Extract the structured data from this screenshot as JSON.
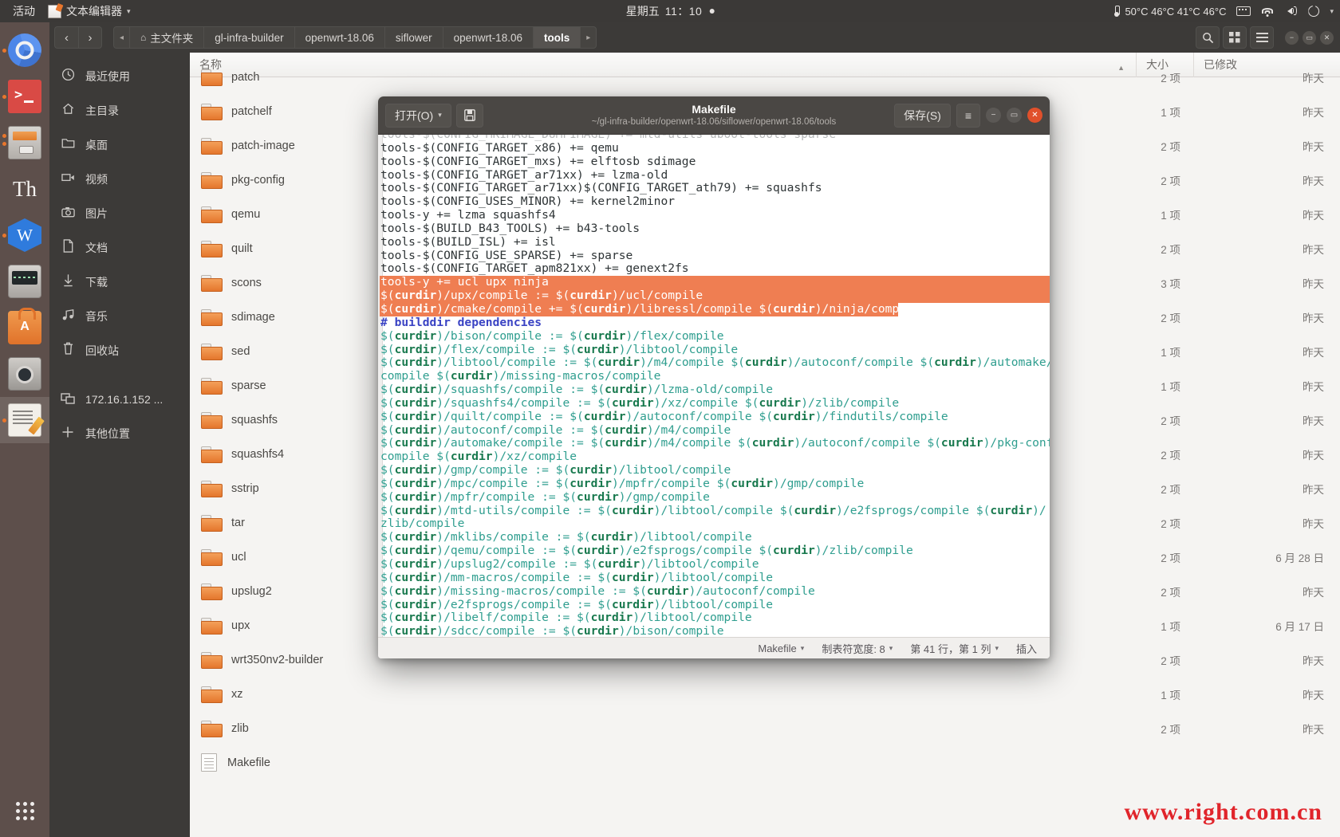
{
  "top_panel": {
    "activities": "活动",
    "app_name": "文本编辑器",
    "app_caret": "▾",
    "weekday": "星期五",
    "clock": "11：10",
    "temperatures": "50°C 46°C 41°C 46°C",
    "system_caret": "▾"
  },
  "launcher": {
    "items": [
      {
        "name": "chromium",
        "running": true
      },
      {
        "name": "terminal",
        "running": true
      },
      {
        "name": "files",
        "running": true
      },
      {
        "name": "thunderbird",
        "running": false
      },
      {
        "name": "wps-office",
        "running": true
      },
      {
        "name": "audio-editor",
        "running": false
      },
      {
        "name": "software-center",
        "running": false
      },
      {
        "name": "camera",
        "running": false
      },
      {
        "name": "text-editor",
        "running": true
      }
    ]
  },
  "file_manager": {
    "nav": {
      "back": "‹",
      "forward": "›"
    },
    "breadcrumb_left_arrow": "◂",
    "breadcrumb_right_arrow": "▸",
    "breadcrumbs": [
      {
        "label": "主文件夹",
        "home": true,
        "current": false
      },
      {
        "label": "gl-infra-builder",
        "current": false
      },
      {
        "label": "openwrt-18.06",
        "current": false
      },
      {
        "label": "siflower",
        "current": false
      },
      {
        "label": "openwrt-18.06",
        "current": false
      },
      {
        "label": "tools",
        "current": true
      }
    ],
    "toolbar_icons": [
      "search-icon",
      "grid-view-icon",
      "menu-icon"
    ],
    "window_buttons": [
      "−",
      "▭",
      "✕"
    ],
    "places": [
      {
        "label": "最近使用",
        "icon": "clock-icon"
      },
      {
        "label": "主目录",
        "icon": "home-icon"
      },
      {
        "label": "桌面",
        "icon": "folder-icon"
      },
      {
        "label": "视频",
        "icon": "video-icon"
      },
      {
        "label": "图片",
        "icon": "camera-icon"
      },
      {
        "label": "文档",
        "icon": "document-icon"
      },
      {
        "label": "下载",
        "icon": "download-icon"
      },
      {
        "label": "音乐",
        "icon": "music-icon"
      },
      {
        "label": "回收站",
        "icon": "trash-icon"
      },
      {
        "label": "172.16.1.152 ...",
        "icon": "network-icon"
      },
      {
        "label": "其他位置",
        "icon": "plus-icon"
      }
    ],
    "columns": {
      "name": "名称",
      "size": "大小",
      "modified": "已修改"
    },
    "sort_indicator": "▲",
    "rows": [
      {
        "name": "patch",
        "type": "folder",
        "size": "2 项",
        "modified": "昨天"
      },
      {
        "name": "patchelf",
        "type": "folder",
        "size": "1 项",
        "modified": "昨天"
      },
      {
        "name": "patch-image",
        "type": "folder",
        "size": "2 项",
        "modified": "昨天"
      },
      {
        "name": "pkg-config",
        "type": "folder",
        "size": "2 项",
        "modified": "昨天"
      },
      {
        "name": "qemu",
        "type": "folder",
        "size": "1 项",
        "modified": "昨天"
      },
      {
        "name": "quilt",
        "type": "folder",
        "size": "2 项",
        "modified": "昨天"
      },
      {
        "name": "scons",
        "type": "folder",
        "size": "3 项",
        "modified": "昨天"
      },
      {
        "name": "sdimage",
        "type": "folder",
        "size": "2 项",
        "modified": "昨天"
      },
      {
        "name": "sed",
        "type": "folder",
        "size": "1 项",
        "modified": "昨天"
      },
      {
        "name": "sparse",
        "type": "folder",
        "size": "1 项",
        "modified": "昨天"
      },
      {
        "name": "squashfs",
        "type": "folder",
        "size": "2 项",
        "modified": "昨天"
      },
      {
        "name": "squashfs4",
        "type": "folder",
        "size": "2 项",
        "modified": "昨天"
      },
      {
        "name": "sstrip",
        "type": "folder",
        "size": "2 项",
        "modified": "昨天"
      },
      {
        "name": "tar",
        "type": "folder",
        "size": "2 项",
        "modified": "昨天"
      },
      {
        "name": "ucl",
        "type": "folder",
        "size": "2 项",
        "modified": "6 月 28 日"
      },
      {
        "name": "upslug2",
        "type": "folder",
        "size": "2 项",
        "modified": "昨天"
      },
      {
        "name": "upx",
        "type": "folder",
        "size": "1 项",
        "modified": "6 月 17 日"
      },
      {
        "name": "wrt350nv2-builder",
        "type": "folder",
        "size": "2 项",
        "modified": "昨天"
      },
      {
        "name": "xz",
        "type": "folder",
        "size": "1 项",
        "modified": "昨天"
      },
      {
        "name": "zlib",
        "type": "folder",
        "size": "2 项",
        "modified": "昨天"
      },
      {
        "name": "Makefile",
        "type": "text",
        "size": "",
        "modified": ""
      }
    ]
  },
  "editor": {
    "open_button": "打开(O)",
    "open_caret": "▾",
    "save_icon_button": "save-icon",
    "save_button": "保存(S)",
    "menu_button": "≡",
    "window_buttons": [
      "−",
      "▭",
      "✕"
    ],
    "title": "Makefile",
    "subtitle": "~/gl-infra-builder/openwrt-18.06/siflower/openwrt-18.06/tools",
    "status": {
      "language": "Makefile",
      "language_caret": "▾",
      "tab_width_label": "制表符宽度: 8",
      "tab_width_caret": "▾",
      "position": "第 41 行，第 1 列",
      "position_caret": "▾",
      "insert_mode": "插入"
    },
    "selection_color": "#ef7e52",
    "lines": [
      {
        "text": "tools-$(CONFIG_MKIMAGE_DUMPIMAGE) += mtd-utils uboot-tools sparse",
        "state": "clipped"
      },
      {
        "text": "tools-$(CONFIG_TARGET_x86) += qemu",
        "state": "normal"
      },
      {
        "text": "tools-$(CONFIG_TARGET_mxs) += elftosb sdimage",
        "state": "normal"
      },
      {
        "text": "tools-$(CONFIG_TARGET_ar71xx) += lzma-old",
        "state": "normal"
      },
      {
        "text": "tools-$(CONFIG_TARGET_ar71xx)$(CONFIG_TARGET_ath79) += squashfs",
        "state": "normal"
      },
      {
        "text": "tools-$(CONFIG_USES_MINOR) += kernel2minor",
        "state": "normal"
      },
      {
        "text": "tools-y += lzma squashfs4",
        "state": "normal"
      },
      {
        "text": "tools-$(BUILD_B43_TOOLS) += b43-tools",
        "state": "normal"
      },
      {
        "text": "tools-$(BUILD_ISL) += isl",
        "state": "normal"
      },
      {
        "text": "tools-$(CONFIG_USE_SPARSE) += sparse",
        "state": "normal"
      },
      {
        "text": "tools-$(CONFIG_TARGET_apm821xx) += genext2fs",
        "state": "normal"
      },
      {
        "text": "tools-y += ucl upx ninja",
        "state": "selected-full"
      },
      {
        "text": "$(curdir)/upx/compile := $(curdir)/ucl/compile",
        "state": "selected-full"
      },
      {
        "text": "$(curdir)/cmake/compile += $(curdir)/libressl/compile $(curdir)/ninja/compile",
        "state": "selected-partial"
      },
      {
        "text": "# builddir dependencies",
        "state": "comment"
      },
      {
        "text": "$(curdir)/bison/compile := $(curdir)/flex/compile",
        "state": "normal"
      },
      {
        "text": "$(curdir)/flex/compile := $(curdir)/libtool/compile",
        "state": "normal"
      },
      {
        "text": "$(curdir)/libtool/compile := $(curdir)/m4/compile $(curdir)/autoconf/compile $(curdir)/automake/",
        "state": "normal"
      },
      {
        "text": "compile $(curdir)/missing-macros/compile",
        "state": "normal"
      },
      {
        "text": "$(curdir)/squashfs/compile := $(curdir)/lzma-old/compile",
        "state": "normal"
      },
      {
        "text": "$(curdir)/squashfs4/compile := $(curdir)/xz/compile $(curdir)/zlib/compile",
        "state": "normal"
      },
      {
        "text": "$(curdir)/quilt/compile := $(curdir)/autoconf/compile $(curdir)/findutils/compile",
        "state": "normal"
      },
      {
        "text": "$(curdir)/autoconf/compile := $(curdir)/m4/compile",
        "state": "normal"
      },
      {
        "text": "$(curdir)/automake/compile := $(curdir)/m4/compile $(curdir)/autoconf/compile $(curdir)/pkg-config/",
        "state": "normal"
      },
      {
        "text": "compile $(curdir)/xz/compile",
        "state": "normal"
      },
      {
        "text": "$(curdir)/gmp/compile := $(curdir)/libtool/compile",
        "state": "normal"
      },
      {
        "text": "$(curdir)/mpc/compile := $(curdir)/mpfr/compile $(curdir)/gmp/compile",
        "state": "normal"
      },
      {
        "text": "$(curdir)/mpfr/compile := $(curdir)/gmp/compile",
        "state": "normal"
      },
      {
        "text": "$(curdir)/mtd-utils/compile := $(curdir)/libtool/compile $(curdir)/e2fsprogs/compile $(curdir)/",
        "state": "normal"
      },
      {
        "text": "zlib/compile",
        "state": "normal"
      },
      {
        "text": "$(curdir)/mklibs/compile := $(curdir)/libtool/compile",
        "state": "normal"
      },
      {
        "text": "$(curdir)/qemu/compile := $(curdir)/e2fsprogs/compile $(curdir)/zlib/compile",
        "state": "normal"
      },
      {
        "text": "$(curdir)/upslug2/compile := $(curdir)/libtool/compile",
        "state": "normal"
      },
      {
        "text": "$(curdir)/mm-macros/compile := $(curdir)/libtool/compile",
        "state": "normal"
      },
      {
        "text": "$(curdir)/missing-macros/compile := $(curdir)/autoconf/compile",
        "state": "normal"
      },
      {
        "text": "$(curdir)/e2fsprogs/compile := $(curdir)/libtool/compile",
        "state": "normal"
      },
      {
        "text": "$(curdir)/libelf/compile := $(curdir)/libtool/compile",
        "state": "normal"
      },
      {
        "text": "$(curdir)/sdcc/compile := $(curdir)/bison/compile",
        "state": "normal"
      }
    ]
  },
  "watermark": "www.right.com.cn"
}
